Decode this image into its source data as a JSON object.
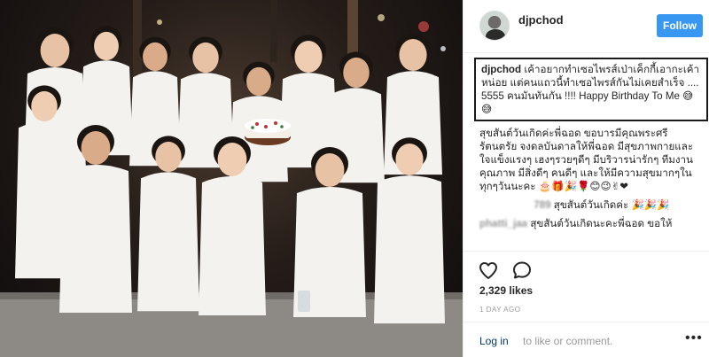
{
  "post": {
    "photo_alt": "",
    "colors": {
      "shirt": "#f4f2ee",
      "night": "#121012",
      "accent": "#3897f0"
    }
  },
  "header": {
    "username": "djpchod",
    "follow_label": "Follow"
  },
  "caption": {
    "username": "djpchod",
    "text": "เค้าอยากทำเซอไพรส์เป่าเค็กกี้เอากะเค้าหน่อย แต่คนแถวนี้ทำเซอไพรส์กันไม่เคยสำเร็จ .... 5555 คนมันทันกัน !!!! Happy Birthday To Me 😅😅"
  },
  "comments": [
    {
      "username": "",
      "text": "สุขสันต์วันเกิดค่ะพี่ฉอด ขอบารมีคุณพระศรีรัตนตรัย จงดลบันดาลให้พี่ฉอด มีสุขภาพกายและใจแข็งแรงๆ เฮงๆรวยๆดีๆ มีบริวารน่ารักๆ ทีมงานคุณภาพ มีสิ่งดีๆ คนดีๆ และให้มีความสุขมากๆในทุกๆวันนะคะ 🎂🎁🎉🌹😊😉✌❤"
    },
    {
      "username": "                   789",
      "text": "สุขสันต์วันเกิดค่ะ 🎉🎉🎉"
    },
    {
      "username": "phatti_jaa",
      "text": "สุขสันต์วันเกิดนะคะพี่ฉอด ขอให้"
    }
  ],
  "actions": {
    "like_icon": "heart-icon",
    "comment_icon": "speech-bubble-icon"
  },
  "stats": {
    "likes": "2,329 likes",
    "time_ago": "1 DAY AGO"
  },
  "footer": {
    "login_link": "Log in",
    "login_text": "to like or comment.",
    "more_icon": "more-options-icon",
    "more_glyph": "•••"
  }
}
